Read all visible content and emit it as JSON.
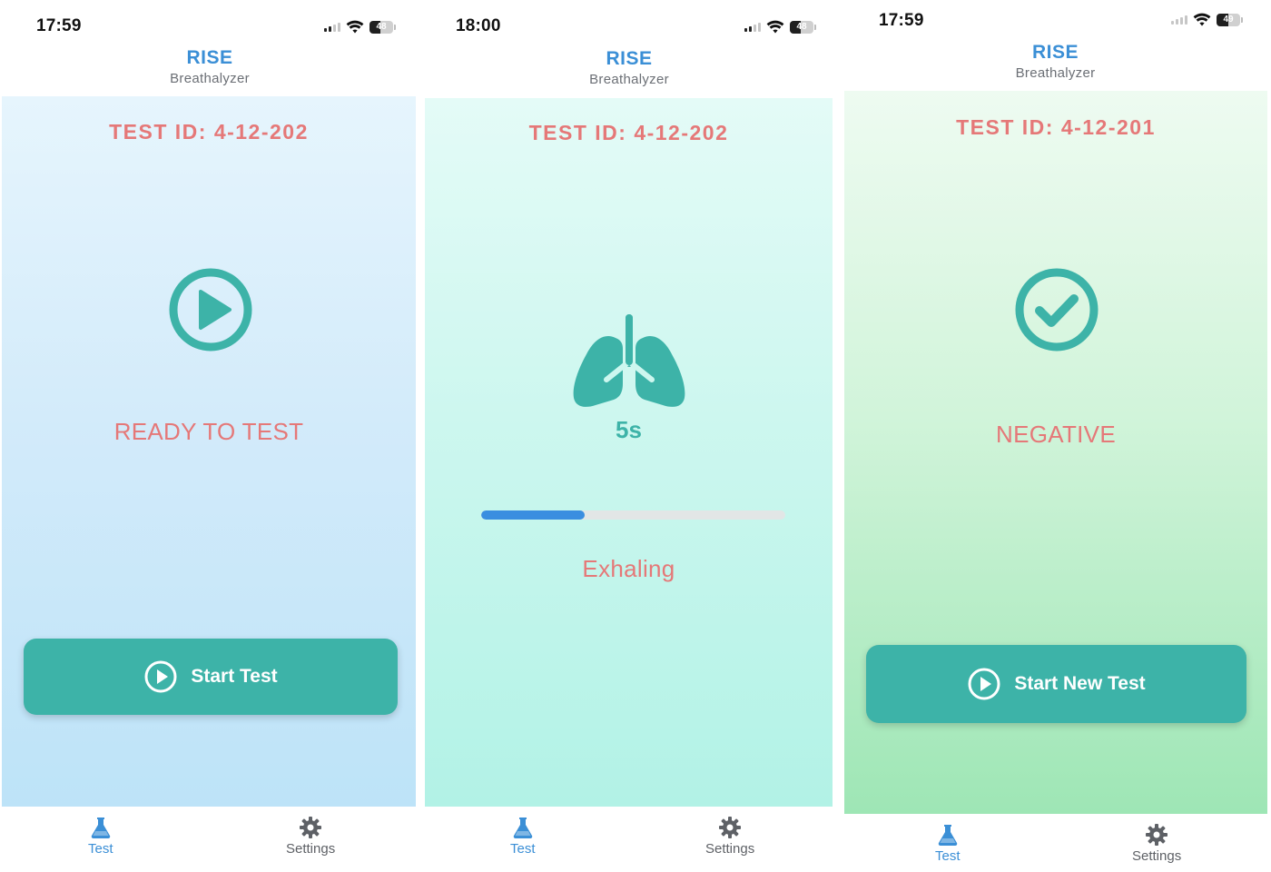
{
  "app": {
    "title": "RISE",
    "subtitle": "Breathalyzer"
  },
  "colors": {
    "accent": "#3b8fd6",
    "teal": "#3db3a8",
    "status_red": "#e57878",
    "progress_blue": "#3a8ee0"
  },
  "tabs": {
    "test": "Test",
    "settings": "Settings",
    "test_icon": "flask-icon",
    "settings_icon": "gear-icon"
  },
  "screens": [
    {
      "time": "17:59",
      "battery": "48",
      "test_id": "TEST ID: 4-12-202",
      "icon": "play-circle-icon",
      "status": "READY TO TEST",
      "button_label": "Start Test",
      "active_tab": "test"
    },
    {
      "time": "18:00",
      "battery": "48",
      "test_id": "TEST ID: 4-12-202",
      "icon": "lungs-icon",
      "timer": "5s",
      "progress": 0.34,
      "status": "Exhaling",
      "active_tab": "test"
    },
    {
      "time": "17:59",
      "battery": "49",
      "test_id": "TEST ID: 4-12-201",
      "icon": "check-circle-icon",
      "status": "NEGATIVE",
      "button_label": "Start New Test",
      "active_tab": "test"
    }
  ]
}
